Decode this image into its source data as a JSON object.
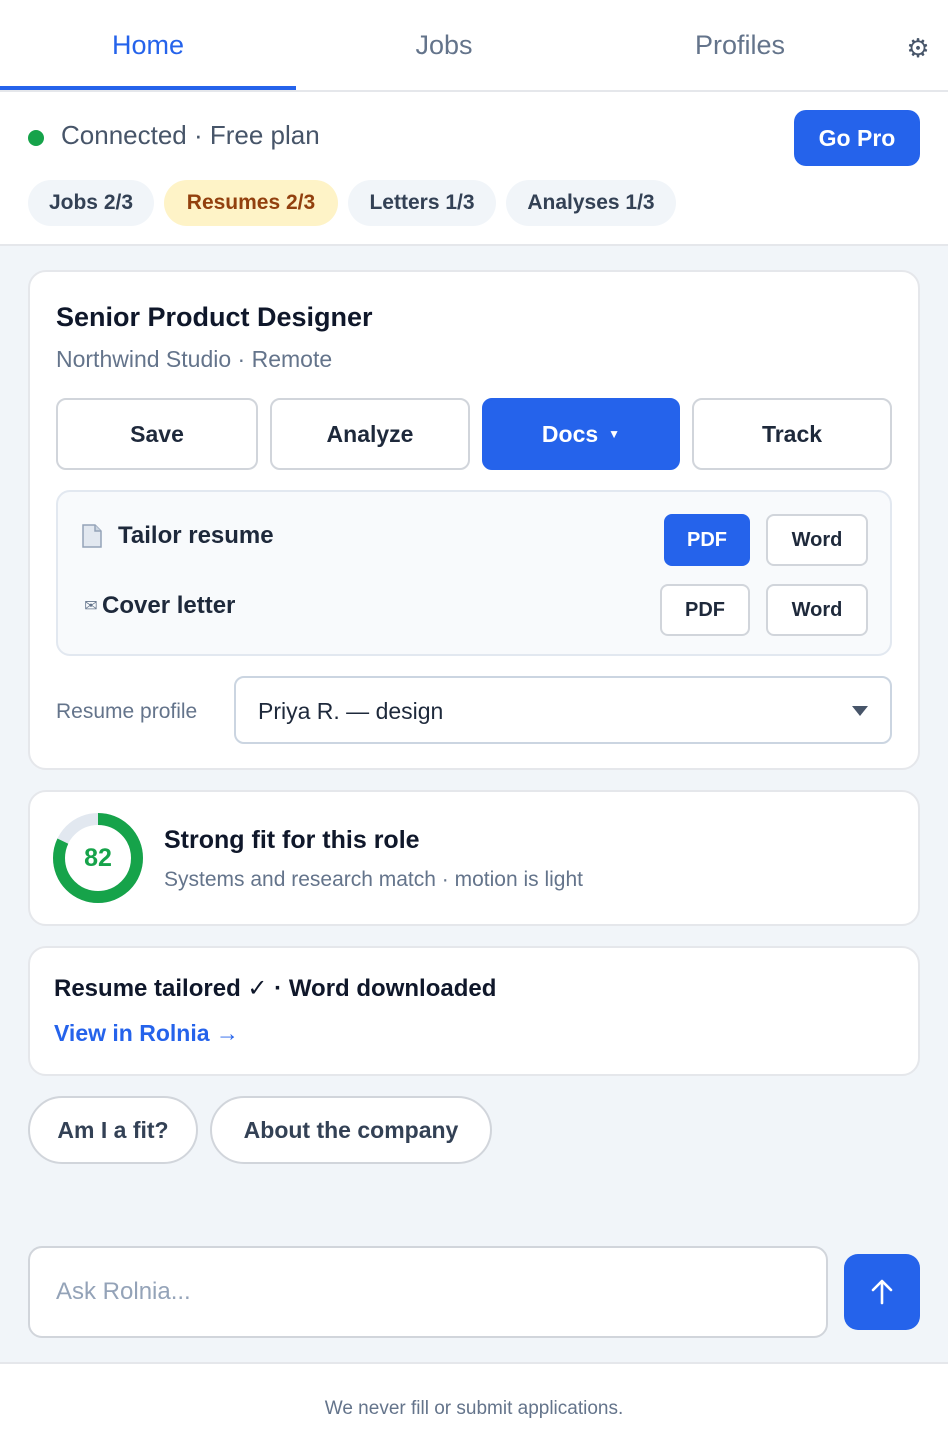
{
  "tabs": [
    {
      "label": "Home",
      "active": true
    },
    {
      "label": "Jobs",
      "active": false
    },
    {
      "label": "Profiles",
      "active": false
    }
  ],
  "status": {
    "text": "Connected · Free plan",
    "go_pro_label": "Go Pro",
    "indicator_color": "#16a34a"
  },
  "usage_chips": [
    {
      "label": "Jobs 2/3"
    },
    {
      "label": "Resumes 2/3",
      "highlight": true
    },
    {
      "label": "Letters 1/3"
    },
    {
      "label": "Analyses 1/3"
    }
  ],
  "job": {
    "title": "Senior Product Designer",
    "subtitle": "Northwind Studio · Remote",
    "actions": {
      "save": "Save",
      "analyze": "Analyze",
      "docs": "Docs",
      "track": "Track"
    },
    "docs": [
      {
        "icon": "document-icon",
        "label": "Tailor resume",
        "pdf": "PDF",
        "word": "Word",
        "pdf_selected": true
      },
      {
        "icon": "envelope-icon",
        "label": "Cover letter",
        "pdf": "PDF",
        "word": "Word",
        "pdf_selected": false
      }
    ],
    "profile_label": "Resume profile",
    "profile_value": "Priya R. — design"
  },
  "fit": {
    "score": "82",
    "score_fraction": 0.82,
    "title": "Strong fit for this role",
    "subtitle": "Systems and research match · motion is light",
    "color": "#16a34a"
  },
  "result": {
    "title": "Resume tailored ✓ · Word downloaded",
    "link": "View in Rolnia →"
  },
  "suggestions": [
    "Am I a fit?",
    "About the company"
  ],
  "ask": {
    "placeholder": "Ask Rolnia..."
  },
  "footer": "We never fill or submit applications.",
  "colors": {
    "accent": "#2563eb",
    "success": "#16a34a",
    "warning_bg": "#fef3c7",
    "warning_text": "#92400e"
  }
}
